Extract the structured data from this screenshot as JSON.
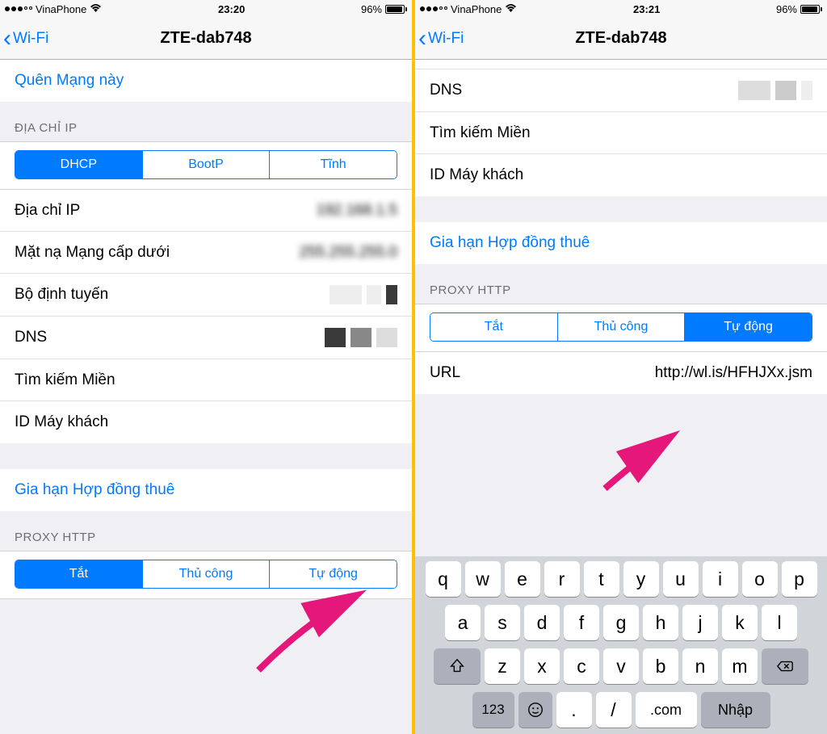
{
  "left": {
    "status": {
      "carrier": "VinaPhone",
      "time": "23:20",
      "battery": "96%"
    },
    "nav": {
      "back": "Wi-Fi",
      "title": "ZTE-dab748"
    },
    "forget": "Quên Mạng này",
    "ip_section": "ĐỊA CHỈ IP",
    "ip_tabs": [
      "DHCP",
      "BootP",
      "Tĩnh"
    ],
    "rows": {
      "ip": "Địa chỉ IP",
      "subnet": "Mặt nạ Mạng cấp dưới",
      "router": "Bộ định tuyến",
      "dns": "DNS",
      "domain": "Tìm kiếm Miền",
      "client": "ID Máy khách"
    },
    "renew": "Gia hạn Hợp đồng thuê",
    "proxy_section": "PROXY HTTP",
    "proxy_tabs": [
      "Tắt",
      "Thủ công",
      "Tự động"
    ]
  },
  "right": {
    "status": {
      "carrier": "VinaPhone",
      "time": "23:21",
      "battery": "96%"
    },
    "nav": {
      "back": "Wi-Fi",
      "title": "ZTE-dab748"
    },
    "rows": {
      "dns": "DNS",
      "domain": "Tìm kiếm Miền",
      "client": "ID Máy khách"
    },
    "renew": "Gia hạn Hợp đồng thuê",
    "proxy_section": "PROXY HTTP",
    "proxy_tabs": [
      "Tắt",
      "Thủ công",
      "Tự động"
    ],
    "url_label": "URL",
    "url_value": "http://wl.is/HFHJXx.jsm",
    "keyboard": {
      "r1": [
        "q",
        "w",
        "e",
        "r",
        "t",
        "y",
        "u",
        "i",
        "o",
        "p"
      ],
      "r2": [
        "a",
        "s",
        "d",
        "f",
        "g",
        "h",
        "j",
        "k",
        "l"
      ],
      "r3": [
        "z",
        "x",
        "c",
        "v",
        "b",
        "n",
        "m"
      ],
      "num": "123",
      "period": ".",
      "slash": "/",
      "dotcom": ".com",
      "enter": "Nhập"
    }
  }
}
